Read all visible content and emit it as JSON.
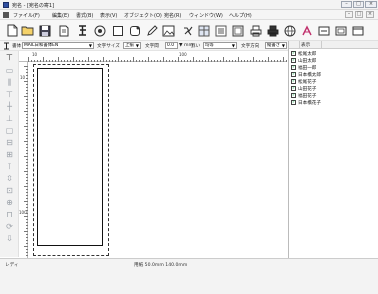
{
  "window": {
    "title": "宛名 - [宛名の寄1]",
    "controls": {
      "minimize": "–",
      "maximize": "□",
      "close": "×"
    }
  },
  "menubar": {
    "items": [
      "ファイル(F)",
      "編集(E)",
      "書式(B)",
      "表示(V)",
      "オブジェクト(O)",
      "宛名(R)",
      "ウィンドウ(W)",
      "ヘルプ(H)"
    ],
    "mdi_controls": {
      "minimize": "–",
      "restore": "□",
      "close": "×"
    }
  },
  "toolbar": {
    "icons": [
      "new-file",
      "open-folder",
      "save",
      "print-preview",
      "font",
      "target",
      "rectangle",
      "rounded-rectangle",
      "pen",
      "image-insert",
      "external",
      "table",
      "list",
      "address-book",
      "print-small",
      "print",
      "globe",
      "text-pink",
      "zoom",
      "zoom-fit",
      "window"
    ]
  },
  "formatbar": {
    "font_label": "書体",
    "font_value": "MAIL日和書体EN",
    "size_label": "文字サイズ",
    "size_value": "上揃",
    "spacing_label": "文字間",
    "spacing_value": "0.0",
    "spacing_unit": "mm",
    "line_label": "罫い",
    "line_value": "均等",
    "direction_label": "文字方向",
    "direction_value": "縦書き"
  },
  "ruler": {
    "top_labels": [
      "10",
      "100"
    ],
    "left_labels": [
      "10",
      "100"
    ]
  },
  "rightpanel": {
    "header": "表示",
    "names": [
      "松尾太郎",
      "山田太郎",
      "福田一郎",
      "日本橋太郎",
      "松尾花子",
      "山田花子",
      "福田花子",
      "日本橋花子"
    ]
  },
  "status": {
    "ready": "レディ",
    "paper": "用紙 50.0mm 140.0mm"
  }
}
